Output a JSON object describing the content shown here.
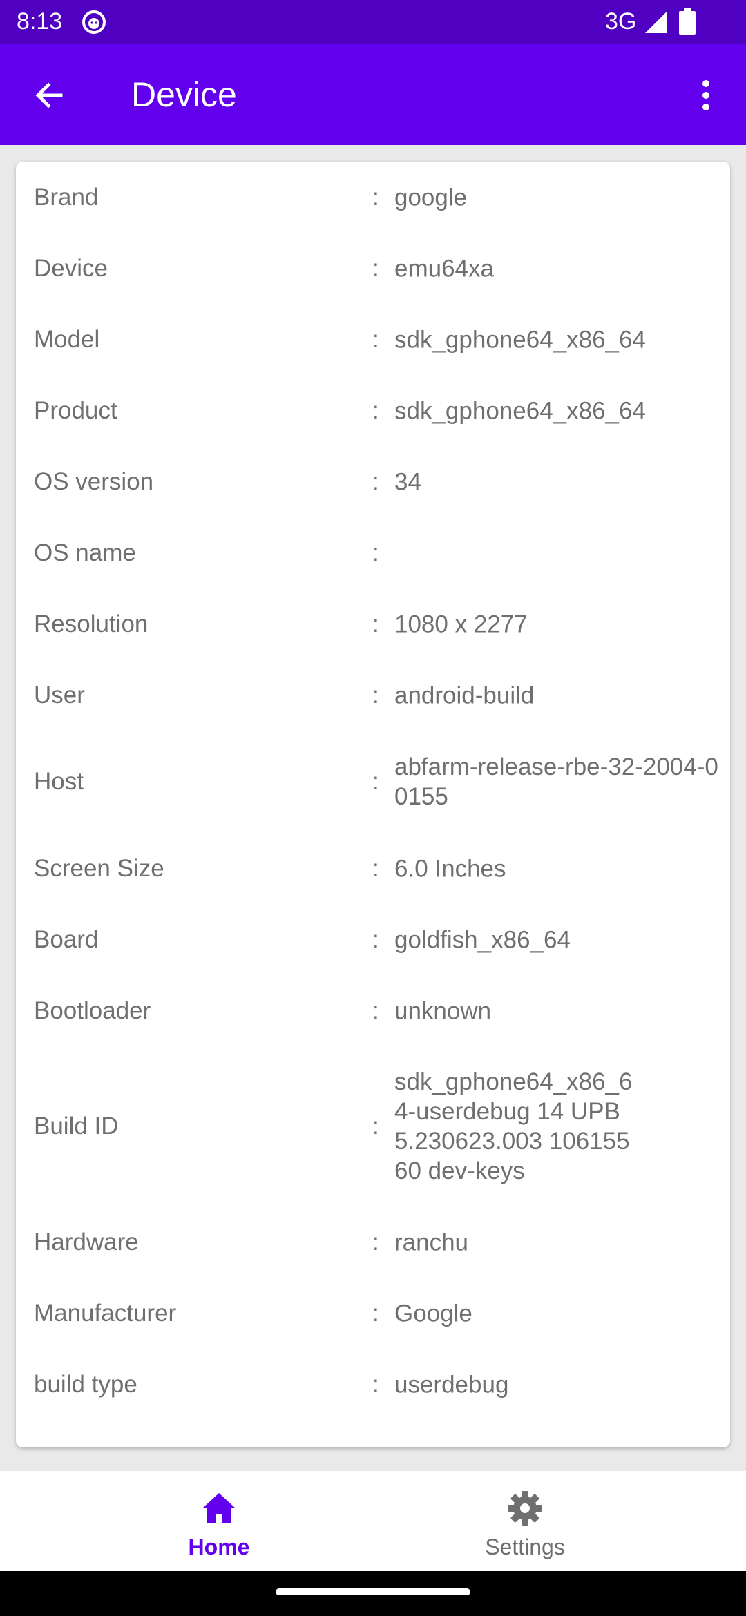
{
  "status_bar": {
    "time": "8:13",
    "network": "3G"
  },
  "app_bar": {
    "title": "Device"
  },
  "rows": [
    {
      "label": "Brand",
      "value": "google"
    },
    {
      "label": "Device",
      "value": "emu64xa"
    },
    {
      "label": "Model",
      "value": "sdk_gphone64_x86_64"
    },
    {
      "label": "Product",
      "value": "sdk_gphone64_x86_64"
    },
    {
      "label": "OS version",
      "value": "34"
    },
    {
      "label": "OS name",
      "value": ""
    },
    {
      "label": "Resolution",
      "value": "1080 x 2277"
    },
    {
      "label": "User",
      "value": "android-build"
    },
    {
      "label": "Host",
      "value": "abfarm-release-rbe-32-2004-00155"
    },
    {
      "label": "Screen Size",
      "value": "6.0 Inches"
    },
    {
      "label": "Board",
      "value": "goldfish_x86_64"
    },
    {
      "label": "Bootloader",
      "value": "unknown"
    },
    {
      "label": "Build ID",
      "value": "sdk_gphone64_x86_64-userdebug 14 UPB5.230623.003 10615560 dev-keys"
    },
    {
      "label": "Hardware",
      "value": "ranchu"
    },
    {
      "label": "Manufacturer",
      "value": "Google"
    },
    {
      "label": "build type",
      "value": "userdebug"
    }
  ],
  "colon": ":",
  "bottom_nav": {
    "items": [
      {
        "label": "Home",
        "icon": "home-icon",
        "active": true
      },
      {
        "label": "Settings",
        "icon": "gear-icon",
        "active": false
      }
    ]
  },
  "colors": {
    "status_bar": "#4f00c0",
    "app_bar": "#6200ee",
    "accent": "#6200ee",
    "text": "#6f6f6f"
  }
}
